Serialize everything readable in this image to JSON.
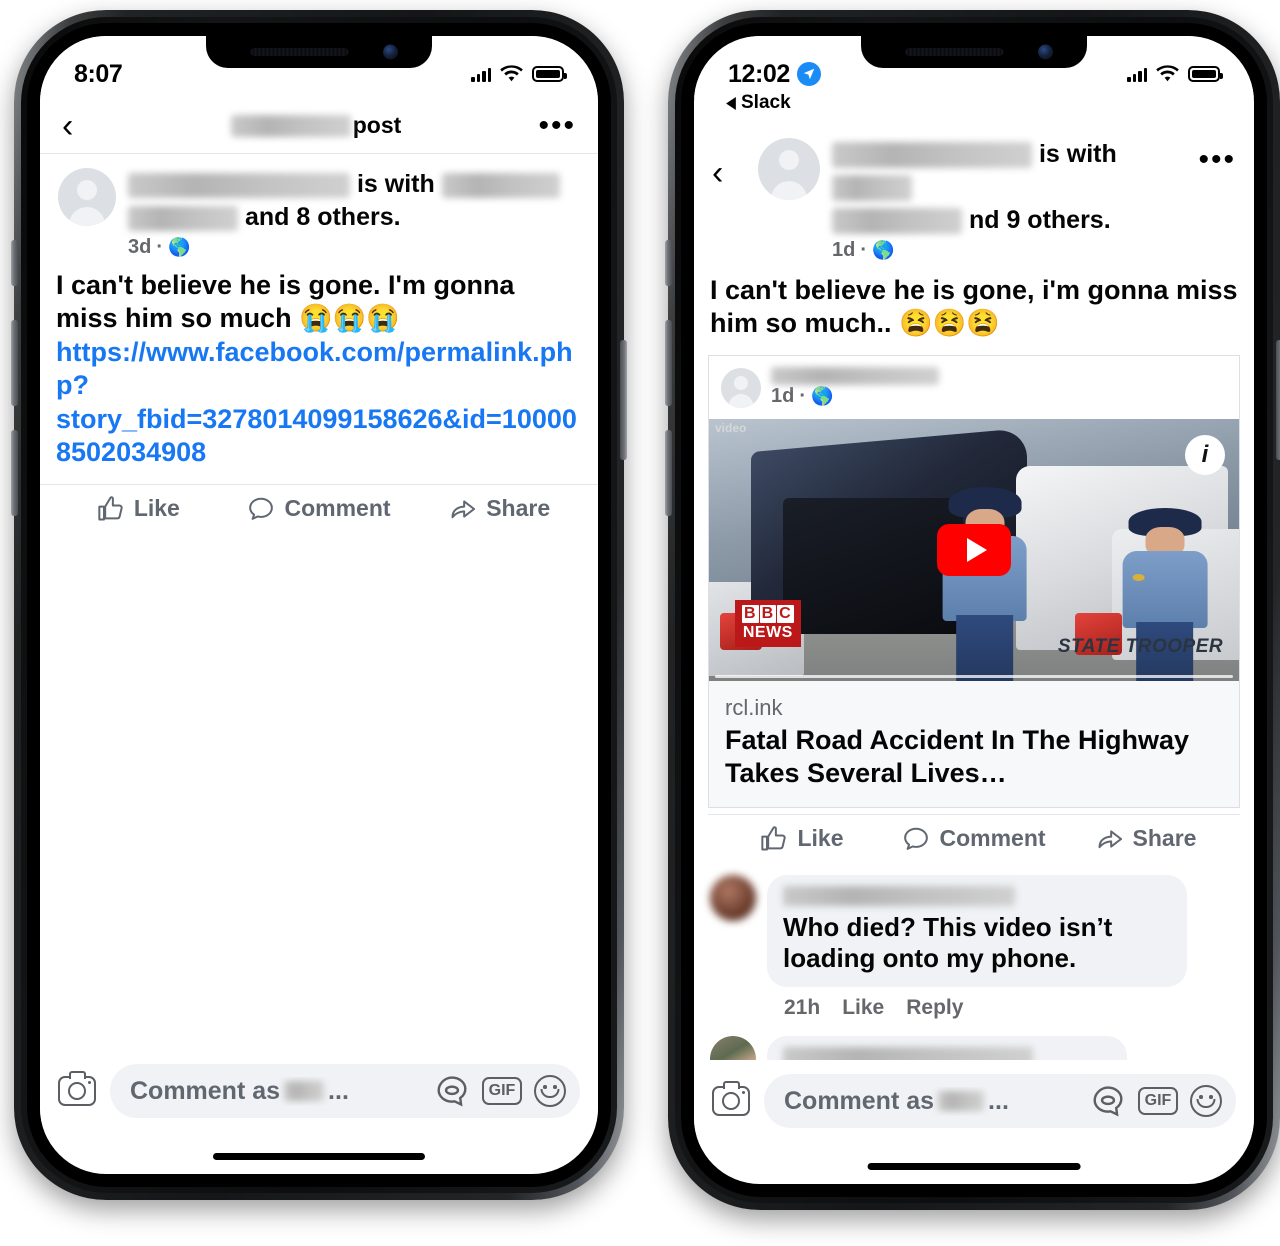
{
  "phones": [
    {
      "id": "phone-left",
      "status_bar": {
        "time": "8:07",
        "has_location_arrow": false,
        "back_to_app": null,
        "signal_icon": "cellular-signal-icon",
        "wifi_icon": "wifi-icon",
        "battery_icon": "battery-icon"
      },
      "nav": {
        "back_icon": "chevron-left-icon",
        "title_redacted": true,
        "title_suffix": "post",
        "menu_icon": "ellipsis-menu-icon"
      },
      "post": {
        "byline_is_with": "is with",
        "byline_and": "and",
        "byline_others": "8 others.",
        "byline_period": ".",
        "timestamp": "3d",
        "separator": "·",
        "audience_icon": "globe-icon",
        "text": "I can't believe he is gone. I'm gonna miss him so much ",
        "emojis": "😭😭😭",
        "link": "https://www.facebook.com/permalink.php?story_fbid=3278014099158626&id=100008502034908"
      },
      "actions": [
        {
          "label": "Like",
          "icon": "thumbs-up-icon"
        },
        {
          "label": "Comment",
          "icon": "comment-bubble-icon"
        },
        {
          "label": "Share",
          "icon": "share-arrow-icon"
        }
      ],
      "compose": {
        "camera_icon": "camera-icon",
        "placeholder_prefix": "Comment as",
        "placeholder_suffix": "...",
        "sticker_icon": "sticker-icon",
        "gif_label": "GIF",
        "emoji_icon": "smiley-icon"
      }
    },
    {
      "id": "phone-right",
      "status_bar": {
        "time": "12:02",
        "has_location_arrow": true,
        "location_icon": "location-arrow-icon",
        "back_to_app": "Slack",
        "back_to_app_icon": "triangle-left-icon",
        "signal_icon": "cellular-signal-icon",
        "wifi_icon": "wifi-icon",
        "battery_icon": "battery-icon"
      },
      "nav": {
        "back_icon": "chevron-left-icon",
        "menu_icon": "ellipsis-menu-icon"
      },
      "post": {
        "byline_is_with": "is with",
        "byline_and": "nd",
        "byline_others": "9 others.",
        "timestamp": "1d",
        "separator": "·",
        "audience_icon": "globe-icon",
        "text": "I can't believe he is gone, i'm gonna miss him so much.. ",
        "emojis": "😫😫😫"
      },
      "embed": {
        "author_redacted": true,
        "timestamp": "1d",
        "separator": "·",
        "audience_icon": "globe-icon",
        "video_label": "video",
        "play_icon": "youtube-play-icon",
        "info_icon": "info-icon",
        "watermark_line1": "BBC",
        "watermark_line2": "NEWS",
        "watermark_letters": [
          "B",
          "B",
          "C"
        ],
        "scene_text": "STATE TROOPER",
        "domain": "rcl.ink",
        "title": "Fatal Road Accident In The Highway Takes Several Lives…"
      },
      "actions": [
        {
          "label": "Like",
          "icon": "thumbs-up-icon"
        },
        {
          "label": "Comment",
          "icon": "comment-bubble-icon"
        },
        {
          "label": "Share",
          "icon": "share-arrow-icon"
        }
      ],
      "comments": [
        {
          "author_redacted": true,
          "text": "Who died? This video isn’t loading onto my phone.",
          "time": "21h",
          "like_label": "Like",
          "reply_label": "Reply"
        },
        {
          "author_redacted": true,
          "text": "",
          "partially_hidden": true
        }
      ],
      "compose": {
        "camera_icon": "camera-icon",
        "placeholder_prefix": "Comment as",
        "placeholder_suffix": "...",
        "sticker_icon": "sticker-icon",
        "gif_label": "GIF",
        "emoji_icon": "smiley-icon"
      }
    }
  ],
  "colors": {
    "link_blue": "#1878f3",
    "fb_text": "#050505",
    "fb_gray": "#65676b",
    "action_gray": "#606770",
    "bubble_gray": "#f0f2f5",
    "youtube_red": "#ff0000",
    "bbc_red": "#bb1919",
    "location_blue": "#1b8cf5"
  }
}
